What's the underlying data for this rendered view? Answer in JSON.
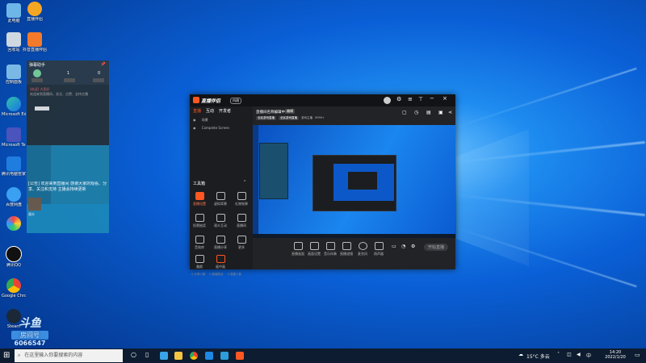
{
  "desktop": {
    "icons": [
      {
        "label": "此电脑"
      },
      {
        "label": "直播伴侣"
      },
      {
        "label": "回收站"
      },
      {
        "label": "抖音直播伴侣"
      },
      {
        "label": "控制面板"
      },
      {
        "label": "Microsoft Edge"
      },
      {
        "label": "Microsoft Teams"
      },
      {
        "label": "腾讯电脑管家"
      },
      {
        "label": "百度网盘"
      },
      {
        "label": "腾讯QQ"
      },
      {
        "label": "Google Chrome"
      },
      {
        "label": "Steam"
      }
    ],
    "watermark": {
      "line1": "斗鱼",
      "line2": "房间号",
      "line3": "6066547"
    }
  },
  "chat": {
    "title": "弹幕助手",
    "count_left": "1",
    "count_right": "0",
    "message1": "[欢迎] 大家好",
    "message2": "欢迎来到直播间，关注、点赞、支持主播",
    "announcement": "[公告] 欢迎来到直播间 感谢大家的观看、分享、关注和支持 主播会持续更新",
    "user": "观众"
  },
  "app": {
    "brand": "直播伴侣",
    "badge": "内测",
    "tabs": [
      "直播",
      "互动",
      "开发者"
    ],
    "scene_label": "场景",
    "source": "Complete Screen",
    "scene_title": "直播间名称编辑中",
    "scene_btn": "编辑",
    "tags": [
      "全民游戏直播",
      "全民游戏直播"
    ],
    "stats": [
      "游戏主播",
      "9999+"
    ],
    "tools_title": "工具箱",
    "tools": [
      "直播设置",
      "虚拟背景",
      "礼物效果",
      "投票抽奖",
      "观众互动",
      "直播间",
      "音效库",
      "直播分享",
      "更多",
      "美颜",
      "画中画"
    ],
    "bottom_tools": [
      "直播画面",
      "画面设置",
      "音乐伴奏",
      "直播滤镜",
      "麦克风",
      "扬声器"
    ],
    "start_btn": "开始直播",
    "status": [
      "0 分享人数",
      "0 新增粉丝",
      "0 观看人数"
    ],
    "accent": "#ff5722"
  },
  "taskbar": {
    "search_placeholder": "在这里输入你要搜索的内容",
    "weather": "15°C 多云",
    "time": "14:20",
    "date": "2022/1/20"
  }
}
